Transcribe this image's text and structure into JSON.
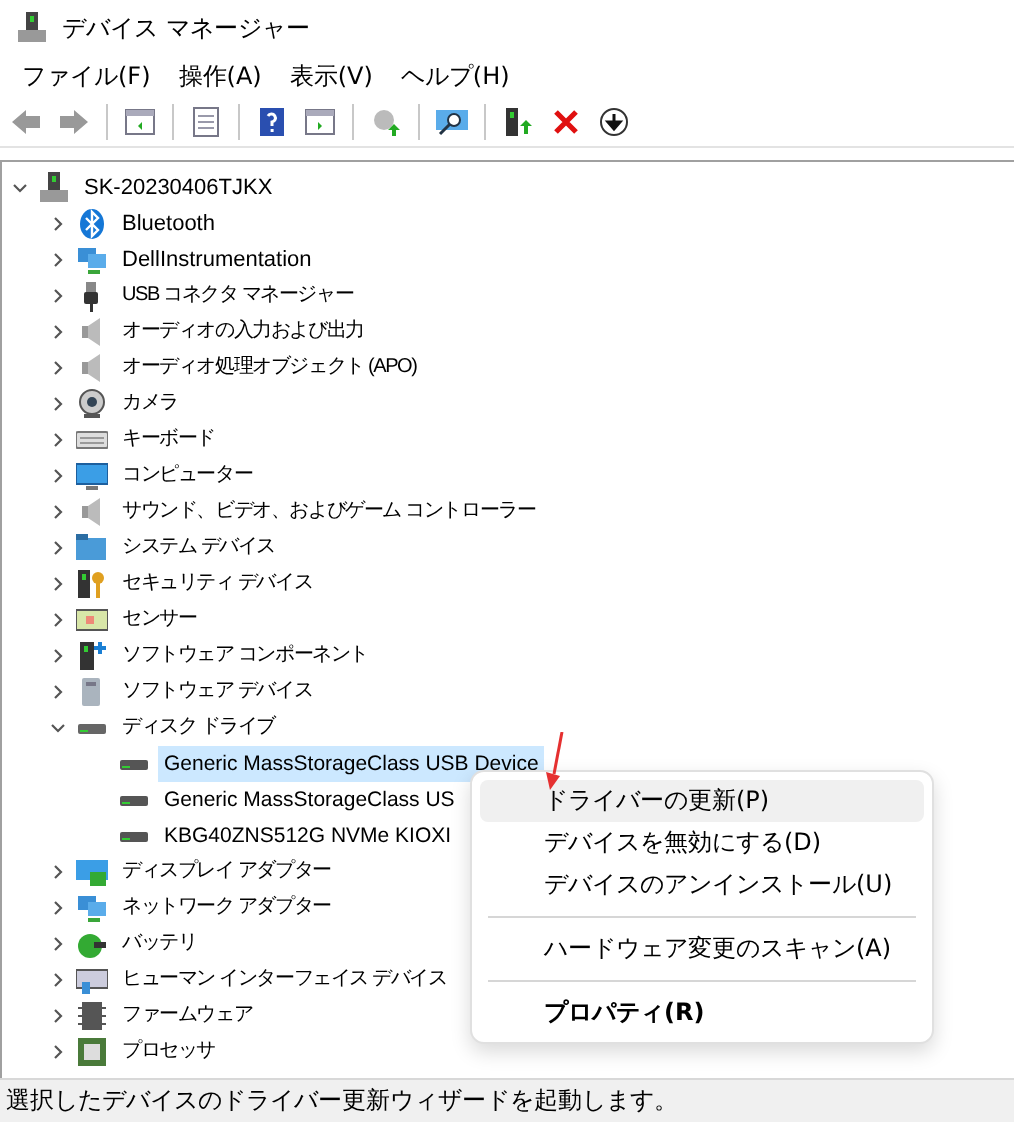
{
  "window": {
    "title": "デバイス マネージャー"
  },
  "menu_bar": [
    {
      "label": "ファイル(F)"
    },
    {
      "label": "操作(A)"
    },
    {
      "label": "表示(V)"
    },
    {
      "label": "ヘルプ(H)"
    }
  ],
  "tree": {
    "label": "SK-20230406TJKX",
    "expanded": true,
    "children": [
      {
        "label": "Bluetooth",
        "expanded": false
      },
      {
        "label": "DellInstrumentation",
        "expanded": false
      },
      {
        "label": "USB コネクタ マネージャー",
        "expanded": false
      },
      {
        "label": "オーディオの入力および出力",
        "expanded": false
      },
      {
        "label": "オーディオ処理オブジェクト (APO)",
        "expanded": false
      },
      {
        "label": "カメラ",
        "expanded": false
      },
      {
        "label": "キーボード",
        "expanded": false
      },
      {
        "label": "コンピューター",
        "expanded": false
      },
      {
        "label": "サウンド、ビデオ、およびゲーム コントローラー",
        "expanded": false
      },
      {
        "label": "システム デバイス",
        "expanded": false
      },
      {
        "label": "セキュリティ デバイス",
        "expanded": false
      },
      {
        "label": "センサー",
        "expanded": false
      },
      {
        "label": "ソフトウェア コンポーネント",
        "expanded": false
      },
      {
        "label": "ソフトウェア デバイス",
        "expanded": false
      },
      {
        "label": "ディスク ドライブ",
        "expanded": true,
        "children": [
          {
            "label": "Generic MassStorageClass USB Device",
            "selected": true
          },
          {
            "label": "Generic MassStorageClass US",
            "selected": false
          },
          {
            "label": "KBG40ZNS512G NVMe KIOXI",
            "selected": false
          }
        ]
      },
      {
        "label": "ディスプレイ アダプター",
        "expanded": false
      },
      {
        "label": "ネットワーク アダプター",
        "expanded": false
      },
      {
        "label": "バッテリ",
        "expanded": false
      },
      {
        "label": "ヒューマン インターフェイス デバイス",
        "expanded": false
      },
      {
        "label": "ファームウェア",
        "expanded": false
      },
      {
        "label": "プロセッサ",
        "expanded": false
      }
    ]
  },
  "context_menu": {
    "items": [
      {
        "kind": "item",
        "label": "ドライバーの更新(P)",
        "highlighted": true,
        "default": false
      },
      {
        "kind": "item",
        "label": "デバイスを無効にする(D)",
        "highlighted": false,
        "default": false
      },
      {
        "kind": "item",
        "label": "デバイスのアンインストール(U)",
        "highlighted": false,
        "default": false
      },
      {
        "kind": "separator"
      },
      {
        "kind": "item",
        "label": "ハードウェア変更のスキャン(A)",
        "highlighted": false,
        "default": false
      },
      {
        "kind": "separator"
      },
      {
        "kind": "item",
        "label": "プロパティ(R)",
        "highlighted": false,
        "default": true
      }
    ]
  },
  "status_bar": "選択したデバイスのドライバー更新ウィザードを起動します。"
}
